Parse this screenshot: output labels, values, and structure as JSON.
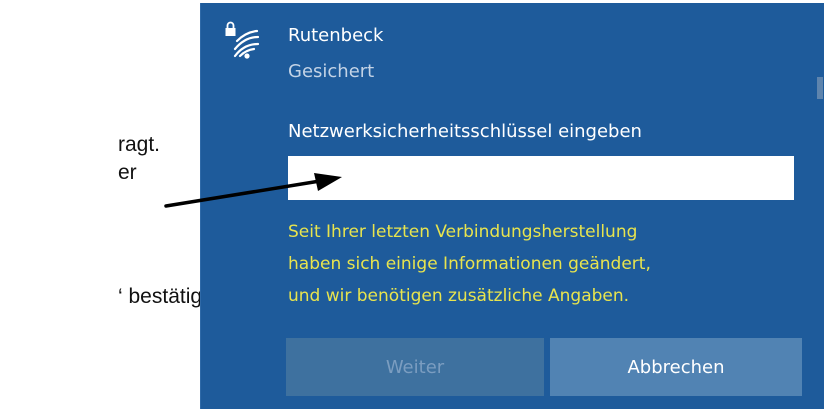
{
  "document": {
    "line_1": "ragt.",
    "line_2": "er",
    "line_3": "‘ bestätigen."
  },
  "wifi_panel": {
    "network_name": "Rutenbeck",
    "network_status": "Gesichert",
    "key_label": "Netzwerksicherheitsschlüssel eingeben",
    "key_value": "",
    "warning_lines": [
      "Seit Ihrer letzten Verbindungsherstellung",
      "haben sich einige Informationen geändert,",
      "und wir benötigen zusätzliche Angaben."
    ],
    "next_button": "Weiter",
    "cancel_button": "Abbrechen",
    "icon": "wifi-secured-icon",
    "colors": {
      "panel_bg": "#1e5b9b",
      "warning_text": "#e8e44e",
      "button_next_bg": "#3e719f",
      "button_cancel_bg": "#5183b3",
      "status_text": "#c3d3e6"
    }
  },
  "annotation": {
    "icon": "pointer-arrow-icon"
  }
}
